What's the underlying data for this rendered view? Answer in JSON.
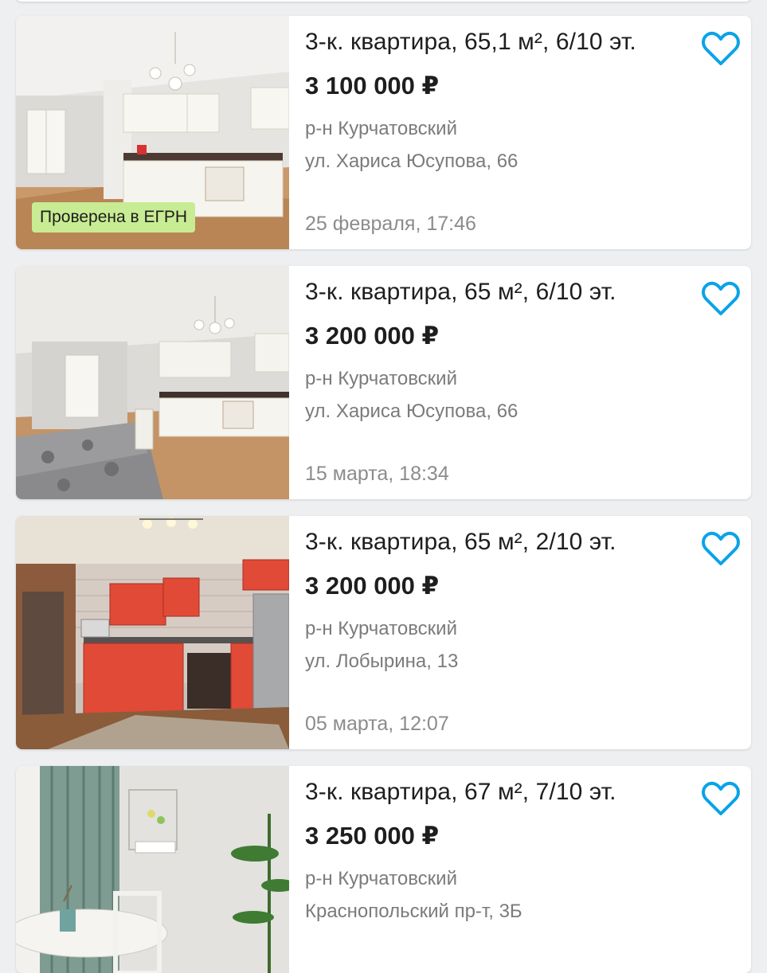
{
  "accent_color": "#0aa3e8",
  "badge_color": "#c8ec93",
  "listings": [
    {
      "title": "3-к. квартира, 65,1 м², 6/10 эт.",
      "price": "3 100 000 ₽",
      "district": "р-н Курчатовский",
      "address": "ул. Хариса Юсупова, 66",
      "date": "25 февраля, 17:46",
      "badge": "Проверена в ЕГРН",
      "photo": "white-kitchen-photo",
      "favorite_icon": "heart-outline-icon"
    },
    {
      "title": "3-к. квартира, 65 м², 6/10 эт.",
      "price": "3 200 000 ₽",
      "district": "р-н Курчатовский",
      "address": "ул. Хариса Юсупова, 66",
      "date": "15 марта, 18:34",
      "photo": "kitchen-with-table-photo",
      "favorite_icon": "heart-outline-icon"
    },
    {
      "title": "3-к. квартира, 65 м², 2/10 эт.",
      "price": "3 200 000 ₽",
      "district": "р-н Курчатовский",
      "address": "ул. Лобырина, 13",
      "date": "05 марта, 12:07",
      "photo": "red-kitchen-photo",
      "favorite_icon": "heart-outline-icon"
    },
    {
      "title": "3-к. квартира, 67 м², 7/10 эт.",
      "price": "3 250 000 ₽",
      "district": "р-н Курчатовский",
      "address": "Краснопольский пр-т, 3Б",
      "photo": "dining-room-photo",
      "favorite_icon": "heart-outline-icon"
    }
  ]
}
